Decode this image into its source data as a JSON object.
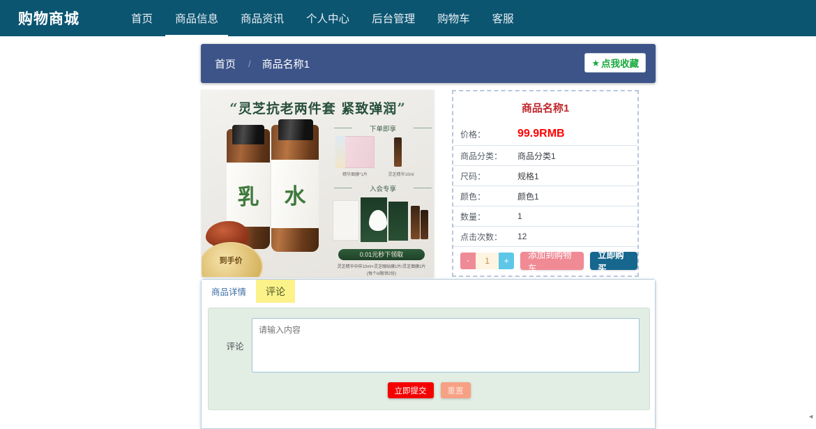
{
  "navbar": {
    "brand": "购物商城",
    "items": [
      {
        "label": "首页",
        "active": false
      },
      {
        "label": "商品信息",
        "active": true
      },
      {
        "label": "商品资讯",
        "active": false
      },
      {
        "label": "个人中心",
        "active": false
      },
      {
        "label": "后台管理",
        "active": false
      },
      {
        "label": "购物车",
        "active": false
      },
      {
        "label": "客服",
        "active": false
      }
    ]
  },
  "breadcrumb": {
    "home": "首页",
    "separator": "/",
    "current": "商品名称1",
    "favorite_button": {
      "icon": "star-icon",
      "glyph": "★",
      "label": "点我收藏"
    }
  },
  "product_image": {
    "alt": "灵芝抗老两件套 商品图",
    "headline": "灵芝抗老两件套 紧致弹润",
    "quote_open": "“",
    "quote_close": "”",
    "bottle_left_label": "乳",
    "bottle_right_label": "水",
    "section_gift": "下单即享",
    "gift_caption_1": "精华面膜*1片",
    "gift_caption_2": "灵芝精华10ml",
    "section_member": "入会专享",
    "pill_text": "0.01元秒下领取",
    "fine_print_1": "灵芝精华中样10ml+灵芝眼贴膜1片/灵芝面膜1片",
    "fine_print_2": "(每个id限领2份)",
    "coin_text": "到手价"
  },
  "info_panel": {
    "title": "商品名称1",
    "rows": [
      {
        "key": "价格：",
        "value": "99.9RMB",
        "highlight": true
      },
      {
        "key": "商品分类：",
        "value": "商品分类1",
        "highlight": false
      },
      {
        "key": "尺码：",
        "value": "规格1",
        "highlight": false
      },
      {
        "key": "颜色：",
        "value": "颜色1",
        "highlight": false
      },
      {
        "key": "数量：",
        "value": "1",
        "highlight": false
      },
      {
        "key": "点击次数：",
        "value": "12",
        "highlight": false
      }
    ],
    "stepper": {
      "minus": "-",
      "quantity": "1",
      "plus": "+"
    },
    "add_to_cart": "添加到购物车",
    "buy_now": "立即购买"
  },
  "tabs": [
    {
      "label": "商品详情",
      "active": false
    },
    {
      "label": "评论",
      "active": true
    }
  ],
  "comment_form": {
    "label": "评论",
    "placeholder": "请输入内容",
    "value": "",
    "submit": "立即提交",
    "reset": "重置"
  },
  "colors": {
    "navbar": "#0b5571",
    "breadcrumb": "#3d5489",
    "accent_red": "#ff0000",
    "title_red": "#c0272d",
    "favorite_green": "#19a83c",
    "tab_active_yellow": "#fbf28a",
    "form_green": "#e2ede4",
    "buy_blue": "#16668e",
    "cart_pink": "#f08a95",
    "submit_red": "#f50000",
    "reset_salmon": "#f7a184"
  },
  "misc": {
    "scroll_arrow": "◄"
  }
}
